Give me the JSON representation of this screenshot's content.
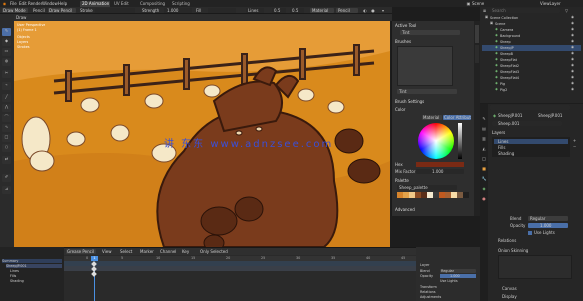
{
  "topbar": {
    "menus": [
      "File",
      "Edit",
      "Render",
      "Window",
      "Help",
      "Draw"
    ],
    "workspaces": [
      "2D Animation",
      "UV Edit",
      "Compositing",
      "Scripting"
    ],
    "active_workspace": "2D Animation",
    "scene_label": "Scene",
    "view_layer_label": "ViewLayer"
  },
  "header": {
    "mode": "Draw Mode",
    "object_label": "Pencil",
    "brush_label": "Draw Pencil",
    "stroke_label": "Stroke",
    "strength_label": "Strength",
    "strength_value": "1.000",
    "fill_label": "Fill",
    "layer_name": "Lines",
    "stabilize_label": "Stabilize",
    "material_label": "Vertex",
    "value_1": "0.5",
    "value_2": "0.5",
    "dropdown_1": "Material",
    "dropdown_2": "Pencil"
  },
  "canvas": {
    "info_lines": [
      "User Perspective",
      "(1) Frame 1",
      "Objects",
      "Layers",
      "Strokes"
    ],
    "watermark": "讲 东东 www.adnzsee.com",
    "colors": {
      "bg": "#d98a1c",
      "bg_light": "#eea84a",
      "fence": "#3b2218",
      "pig": "#7a3b1c",
      "pig_dark": "#5a2a14",
      "sheep": "#f5e8c8",
      "sheep_dark": "#7c4a2a",
      "grass": "#b86a12"
    }
  },
  "npanel": {
    "title": "Active Tool",
    "tool_name": "Tint",
    "section_brushes": "Brushes",
    "brush_name": "Tint",
    "section_brush_settings": "Brush Settings",
    "color_label": "Color",
    "color_mode_a": "Material",
    "color_mode_b": "Color Attribute",
    "hex_label": "Hex",
    "mix_label": "Mix Factor",
    "mix_value": "1.000",
    "swatches_label": "Palette",
    "palette_name": "Sheep_palette",
    "advanced_label": "Advanced",
    "swatches": [
      "#d6842c",
      "#e3a24a",
      "#f0c888",
      "#8a4a22",
      "#5a2e18",
      "#f5ead0",
      "#3a3a3a",
      "#c05a20",
      "#a86030",
      "#f8dca8",
      "#7a5a40",
      "#202020"
    ]
  },
  "outliner": {
    "title": "Outliner",
    "search_placeholder": "Search",
    "items": [
      {
        "name": "Scene Collection",
        "indent": 0
      },
      {
        "name": "Scene",
        "indent": 1
      },
      {
        "name": "Camera",
        "indent": 2
      },
      {
        "name": "Background",
        "indent": 2
      },
      {
        "name": "Sheep",
        "indent": 2
      },
      {
        "name": "SheepJP",
        "indent": 2
      },
      {
        "name": "SheepB",
        "indent": 2
      },
      {
        "name": "SheepFlat",
        "indent": 2
      },
      {
        "name": "SheepFlat2",
        "indent": 2
      },
      {
        "name": "SheepFlat3",
        "indent": 2
      },
      {
        "name": "SheepFlat4",
        "indent": 2
      },
      {
        "name": "Pig",
        "indent": 2
      },
      {
        "name": "Pig2",
        "indent": 2
      }
    ],
    "selected_index": 5
  },
  "properties": {
    "object_name": "SheepJP.001",
    "data_name": "SheepJP.001",
    "data_block": "Sheep.001",
    "layers_label": "Layers",
    "layer_items": [
      "Lines",
      "Fills",
      "Shading"
    ],
    "active_layer": "Lines",
    "blend_label": "Blend",
    "blend_value": "Regular",
    "opacity_label": "Opacity",
    "opacity_value": "1.000",
    "lights_label": "Use Lights",
    "relations_label": "Relations",
    "adjustments_label": "Adjustments",
    "display_label": "Display",
    "onion_label": "Onion Skinning",
    "mode_label": "Mode",
    "mode_value": "Keyframes",
    "vertex_label": "Vertex Paint",
    "canvas_label": "Canvas"
  },
  "timeline": {
    "header_items": [
      "Dope Sheet",
      "View",
      "Select",
      "Marker",
      "Channel",
      "Key",
      "Summary"
    ],
    "mode": "Grease Pencil",
    "only_selected": "Only Selected",
    "layer_rows": [
      "Summary",
      "SheepJP.001",
      "Lines",
      "Fills",
      "Shading"
    ],
    "frame_numbers": [
      "0",
      "5",
      "10",
      "15",
      "20",
      "25",
      "30",
      "35",
      "40",
      "45"
    ],
    "current_frame": "1",
    "tl_props": [
      "Layer",
      "Blend",
      "Opacity",
      "Lights"
    ],
    "tl_values": [
      "Regular",
      "1.000",
      "Use Lights"
    ],
    "tl_props2": [
      "Transform",
      "Relations",
      "Adjustments"
    ]
  }
}
